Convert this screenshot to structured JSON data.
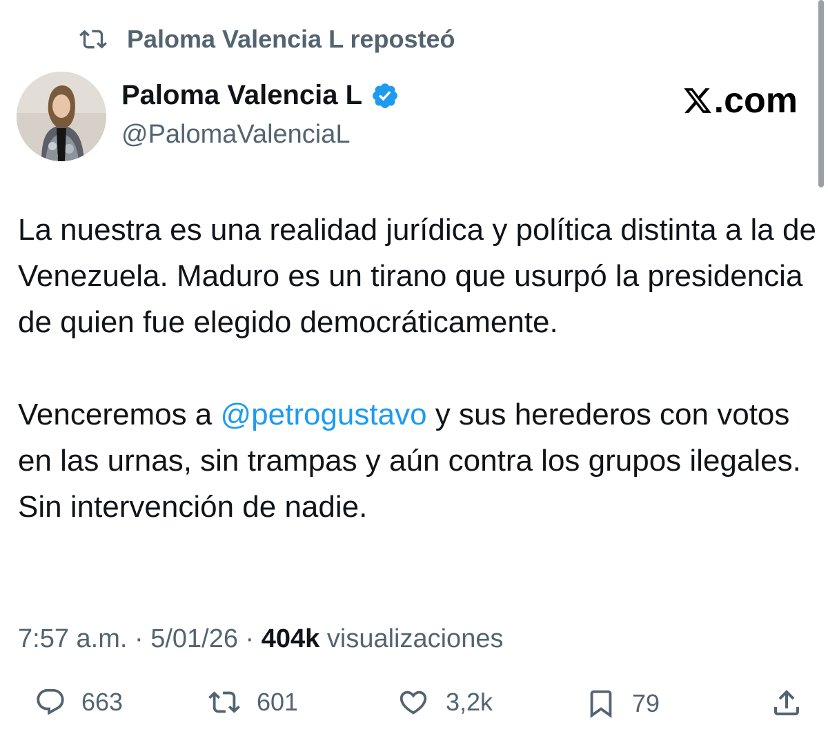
{
  "repost": {
    "icon": "repost-icon",
    "label": "Paloma Valencia L reposteó"
  },
  "author": {
    "name": "Paloma Valencia L",
    "handle": "@PalomaValenciaL",
    "verified_icon": "verified-badge-icon",
    "verified_color": "#1d9bf0"
  },
  "brand": {
    "suffix": ".com",
    "icon": "x-logo-icon"
  },
  "tweet": {
    "paragraph_1": "La nuestra es una realidad jurídica y política  distinta a la de Venezuela.  Maduro es un tirano que usurpó la presidencia de quien fue elegido democráticamente.",
    "paragraph_2_before": "Venceremos a ",
    "mention": "@petrogustavo",
    "paragraph_2_after": " y sus herederos con votos en las urnas, sin trampas y aún contra los grupos ilegales. Sin intervención de nadie.",
    "mention_color": "#1d9bf0"
  },
  "meta": {
    "time": "7:57 a.m.",
    "separator": " · ",
    "date": "5/01/26",
    "views_count": "404k",
    "views_label": " visualizaciones"
  },
  "actions": {
    "replies": {
      "icon": "reply-icon",
      "count": "663"
    },
    "reposts": {
      "icon": "repost-icon",
      "count": "601"
    },
    "likes": {
      "icon": "heart-icon",
      "count": "3,2k"
    },
    "bookmarks": {
      "icon": "bookmark-icon",
      "count": "79"
    },
    "share": {
      "icon": "share-icon"
    }
  },
  "colors": {
    "secondary_text": "#536471",
    "primary_text": "#0f1419"
  }
}
